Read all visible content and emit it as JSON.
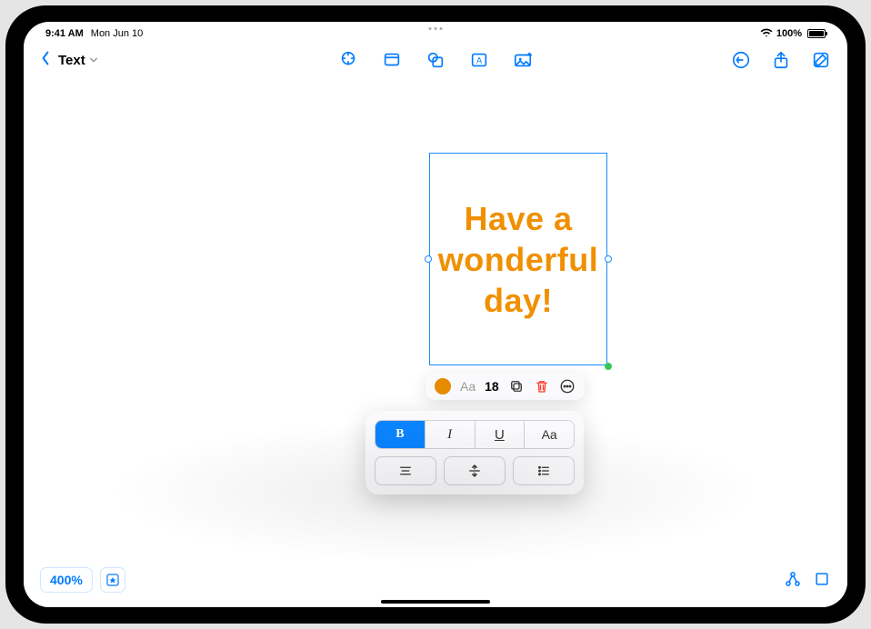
{
  "status": {
    "time": "9:41 AM",
    "date": "Mon Jun 10",
    "battery_pct": "100%"
  },
  "toolbar": {
    "back_label": "Text"
  },
  "canvas": {
    "text_box": {
      "content": "Have a wonderful day!",
      "color": "#f09000"
    }
  },
  "text_toolbar": {
    "font_label": "Aa",
    "font_size": "18"
  },
  "format_panel": {
    "bold": "B",
    "italic": "I",
    "underline": "U",
    "text_case": "Aa"
  },
  "bottom": {
    "zoom": "400%"
  }
}
